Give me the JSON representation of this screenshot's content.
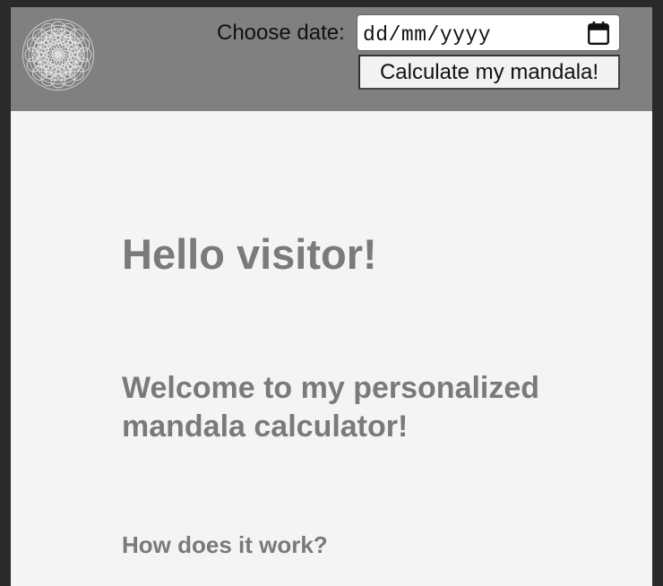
{
  "header": {
    "logo_icon": "mandala-logo-icon",
    "date_label": "Choose date:",
    "date_placeholder": "dd/mm/yyyy",
    "calendar_icon": "calendar-icon",
    "calculate_button_label": "Calculate my mandala!"
  },
  "main": {
    "greeting": "Hello visitor!",
    "welcome": "Welcome to my personalized mandala calculator!",
    "how_it_works_heading": "How does it work?"
  },
  "colors": {
    "header_bg": "#808080",
    "page_bg": "#f4f4f4",
    "heading_text": "#7a7a7a"
  }
}
